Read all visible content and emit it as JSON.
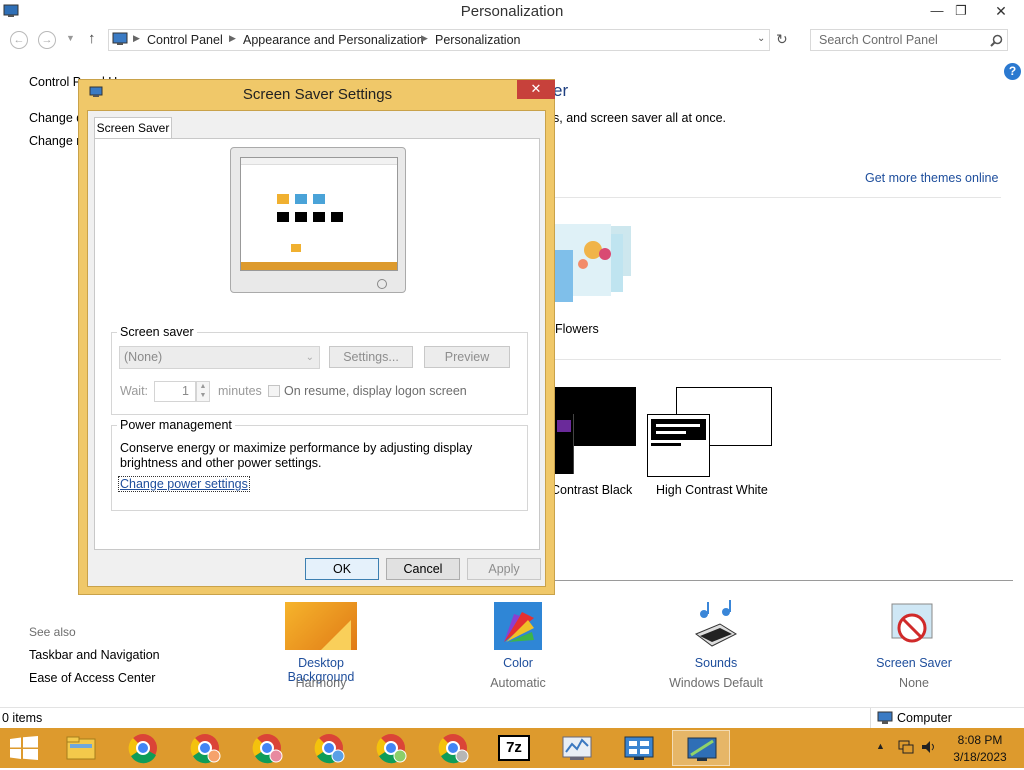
{
  "window": {
    "title": "Personalization"
  },
  "address": {
    "crumbs": [
      "Control Panel",
      "Appearance and Personalization",
      "Personalization"
    ],
    "search_placeholder": "Search Control Panel"
  },
  "left": {
    "home": "Control Panel Home",
    "links": [
      "Change desktop icons",
      "Change mouse pointers"
    ],
    "see_also_title": "See also",
    "see_also": [
      "Taskbar and Navigation",
      "Ease of Access Center"
    ]
  },
  "main": {
    "heading_fragment": "er",
    "subtitle_fragment": "s, and screen saver all at once.",
    "get_more": "Get more themes online",
    "themes": [
      {
        "name": "Flowers"
      },
      {
        "name": "Contrast Black"
      },
      {
        "name": "High Contrast White"
      }
    ],
    "bottom": [
      {
        "title": "Desktop Background",
        "sub": "Harmony"
      },
      {
        "title": "Color",
        "sub": "Automatic"
      },
      {
        "title": "Sounds",
        "sub": "Windows Default"
      },
      {
        "title": "Screen Saver",
        "sub": "None"
      }
    ]
  },
  "dialog": {
    "title": "Screen Saver Settings",
    "tab": "Screen Saver",
    "screen_saver_group": "Screen saver",
    "selected": "(None)",
    "settings_btn": "Settings...",
    "preview_btn": "Preview",
    "wait_label": "Wait:",
    "wait_value": "1",
    "minutes": "minutes",
    "resume_label": "On resume, display logon screen",
    "power_group": "Power management",
    "power_text_1": "Conserve energy or maximize performance by adjusting display",
    "power_text_2": "brightness and other power settings.",
    "power_link": "Change power settings",
    "ok": "OK",
    "cancel": "Cancel",
    "apply": "Apply"
  },
  "status": {
    "items": "0 items",
    "computer": "Computer"
  },
  "taskbar": {
    "time": "8:08 PM",
    "date": "3/18/2023",
    "seven_zip": "7z"
  },
  "colors": {
    "taskbar": "#dd9a2d",
    "dialog_frame": "#f0c869",
    "link": "#1e4e9c",
    "close": "#c7413b"
  }
}
